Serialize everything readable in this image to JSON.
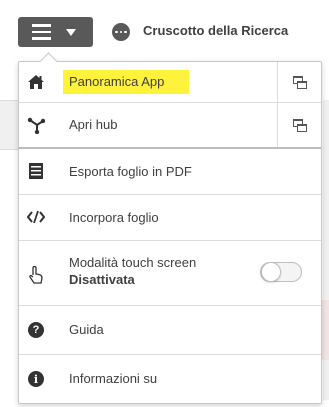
{
  "header": {
    "app_title": "Cruscotto della Ricerca"
  },
  "menu": {
    "items": [
      {
        "label": "Panoramica App",
        "icon": "home-icon",
        "highlight_color": "#fff23a"
      },
      {
        "label": "Apri hub",
        "icon": "hub-icon"
      },
      {
        "label": "Esporta foglio in PDF",
        "icon": "pdf-export-icon"
      },
      {
        "label": "Incorpora foglio",
        "icon": "embed-code-icon"
      },
      {
        "label": "Modalità touch screen",
        "sublabel": "Disattivata",
        "icon": "touch-icon",
        "toggle_on": false
      },
      {
        "label": "Guida",
        "icon": "help-icon",
        "glyph": "?"
      },
      {
        "label": "Informazioni su",
        "icon": "info-icon",
        "glyph": "i"
      }
    ]
  },
  "colors": {
    "menu_button": "#595959",
    "highlight": "#fff23a",
    "text": "#404040"
  }
}
